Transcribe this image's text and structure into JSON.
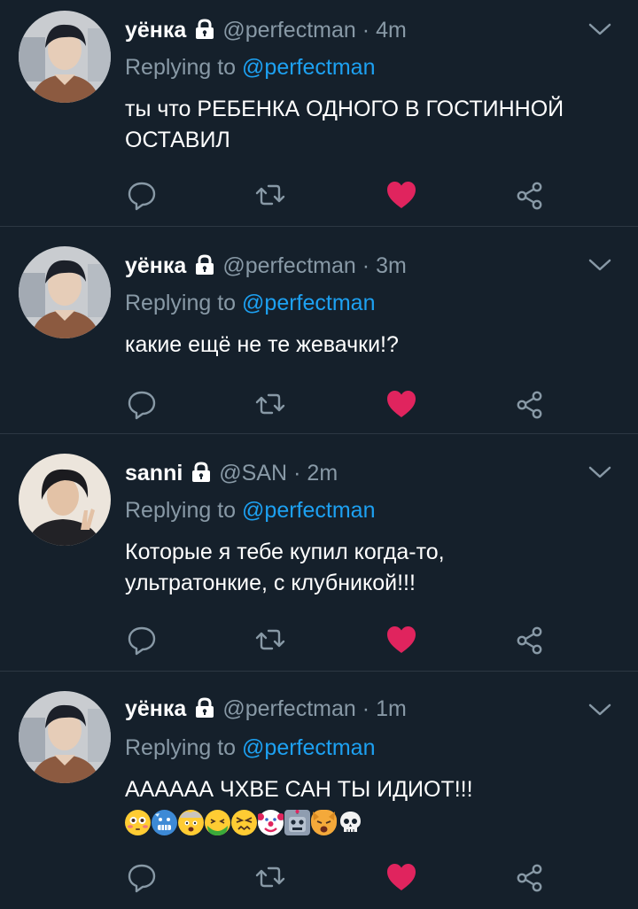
{
  "tweets": [
    {
      "name": "уёнка",
      "handle": "@perfectman",
      "time": "4m",
      "replying_prefix": "Replying to",
      "replying_to": "@perfectman",
      "text": "ты что РЕБЕНКА ОДНОГО В ГОСТИННОЙ ОСТАВИЛ",
      "liked": true
    },
    {
      "name": "уёнка",
      "handle": "@perfectman",
      "time": "3m",
      "replying_prefix": "Replying to",
      "replying_to": "@perfectman",
      "text": "какие ещё не те жевачки!?",
      "liked": true
    },
    {
      "name": "sanni",
      "handle": "@SAN",
      "time": "2m",
      "replying_prefix": "Replying to",
      "replying_to": "@perfectman",
      "text": "Которые я тебе купил когда-то, ультратонкие, с клубникой!!!",
      "liked": true
    },
    {
      "name": "уёнка",
      "handle": "@perfectman",
      "time": "1m",
      "replying_prefix": "Replying to",
      "replying_to": "@perfectman",
      "text": "АААААА ЧХВЕ САН ТЫ ИДИОТ!!!",
      "emojis": [
        "flushed-face",
        "cold-face",
        "exploding-head",
        "nauseated-face",
        "confounded-face",
        "clown-face",
        "robot-face",
        "weary-cat-face",
        "skull"
      ],
      "liked": true
    }
  ],
  "icons": {
    "reply": "reply-icon",
    "retweet": "retweet-icon",
    "like": "heart-icon",
    "share": "share-icon",
    "protected": "lock-icon",
    "menu": "chevron-down-icon"
  },
  "colors": {
    "background": "#15202b",
    "text": "#ffffff",
    "muted": "#8899a6",
    "link": "#1da1f2",
    "like": "#e0245e",
    "divider": "#2c3743"
  }
}
